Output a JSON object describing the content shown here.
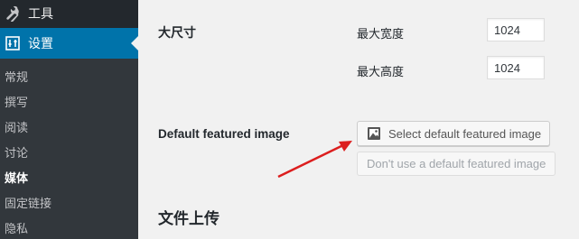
{
  "sidebar": {
    "tools_label": "工具",
    "settings_label": "设置",
    "submenu": [
      {
        "label": "常规",
        "current": false
      },
      {
        "label": "撰写",
        "current": false
      },
      {
        "label": "阅读",
        "current": false
      },
      {
        "label": "讨论",
        "current": false
      },
      {
        "label": "媒体",
        "current": true
      },
      {
        "label": "固定链接",
        "current": false
      },
      {
        "label": "隐私",
        "current": false
      }
    ]
  },
  "large_size": {
    "label": "大尺寸",
    "max_width_label": "最大宽度",
    "max_width_value": "1024",
    "max_height_label": "最大高度",
    "max_height_value": "1024"
  },
  "featured_image": {
    "label": "Default featured image",
    "select_button": "Select default featured image",
    "remove_button": "Don't use a default featured image"
  },
  "uploads_section_title": "文件上传",
  "colors": {
    "admin_bg": "#23282d",
    "submenu_bg": "#32373c",
    "accent": "#0073aa",
    "arrow": "#dc1e1e"
  },
  "icons": [
    "wrench-icon",
    "settings-icon",
    "image-icon"
  ]
}
